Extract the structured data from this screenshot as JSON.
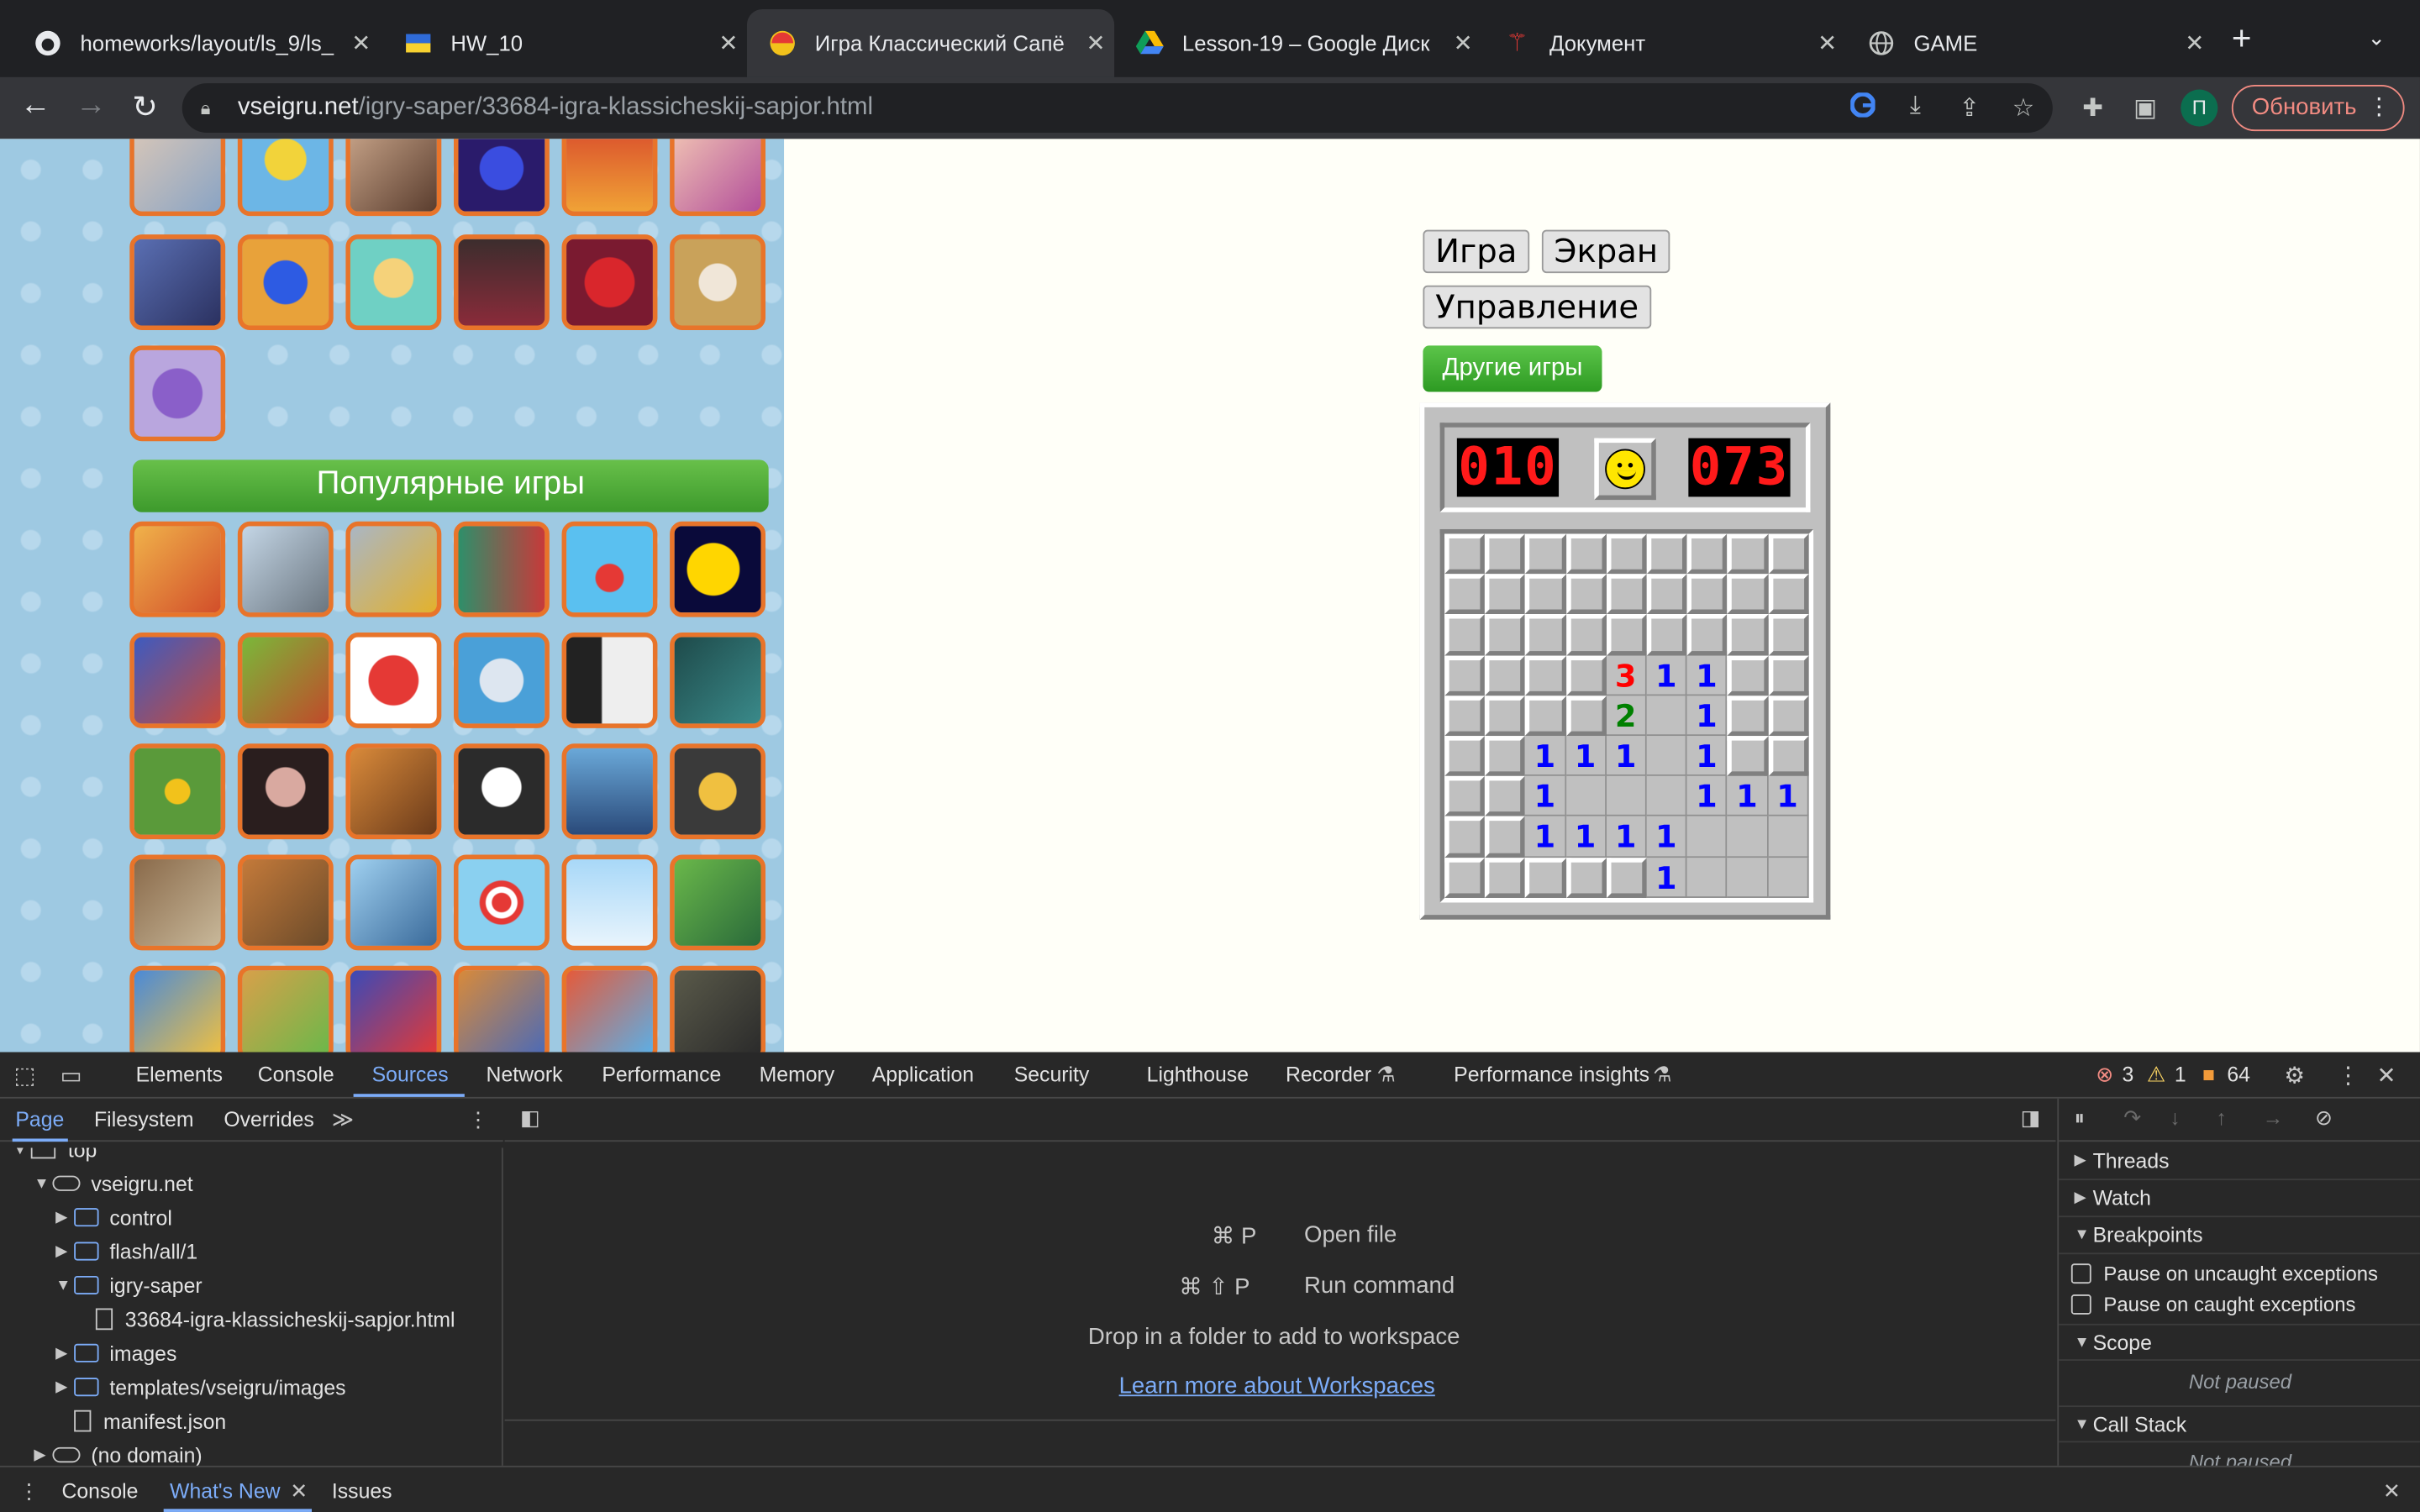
{
  "tabs": [
    {
      "title": "homeworks/layout/ls_9/ls_",
      "icon": "github-icon"
    },
    {
      "title": "HW_10",
      "icon": "ukraine-flag-icon"
    },
    {
      "title": "Игра Классический Сапё",
      "icon": "vseigru-icon",
      "active": true
    },
    {
      "title": "Lesson-19 – Google Диск",
      "icon": "google-drive-icon"
    },
    {
      "title": "Документ",
      "icon": "document-icon"
    },
    {
      "title": "GAME",
      "icon": "globe-icon"
    }
  ],
  "toolbar": {
    "url_domain": "vseigru.net",
    "url_path": "/igry-saper/33684-igra-klassicheskij-sapjor.html",
    "update_label": "Обновить",
    "avatar_letter": "П"
  },
  "sidebar": {
    "popular_title": "Популярные игры"
  },
  "game_menu": {
    "game_button": "Игра",
    "screen_button": "Экран",
    "controls_button": "Управление",
    "other_games_button": "Другие игры"
  },
  "minesweeper": {
    "mines_counter": "010",
    "timer": "073",
    "board": [
      [
        "#",
        "#",
        "#",
        "#",
        "#",
        "#",
        "#",
        "#",
        "#"
      ],
      [
        "#",
        "#",
        "#",
        "#",
        "#",
        "#",
        "#",
        "#",
        "#"
      ],
      [
        "#",
        "#",
        "#",
        "#",
        "#",
        "#",
        "#",
        "#",
        "#"
      ],
      [
        "#",
        "#",
        "#",
        "#",
        "3",
        "1",
        "1",
        "#",
        "#"
      ],
      [
        "#",
        "#",
        "#",
        "#",
        "2",
        "",
        "1",
        "#",
        "#"
      ],
      [
        "#",
        "#",
        "1",
        "1",
        "1",
        "",
        "1",
        "#",
        "#"
      ],
      [
        "#",
        "#",
        "1",
        "",
        "",
        "",
        "1",
        "1",
        "1"
      ],
      [
        "#",
        "#",
        "1",
        "1",
        "1",
        "1",
        "",
        "",
        ""
      ],
      [
        "#",
        "#",
        "#",
        "#",
        "#",
        "1",
        "",
        "",
        ""
      ]
    ],
    "number_colors": {
      "1": "#0000ff",
      "2": "#008000",
      "3": "#ff0000"
    }
  },
  "devtools": {
    "tabs": [
      "Elements",
      "Console",
      "Sources",
      "Network",
      "Performance",
      "Memory",
      "Application",
      "Security",
      "Lighthouse",
      "Recorder",
      "Performance insights"
    ],
    "active_tab": "Sources",
    "errors": "3",
    "warnings": "1",
    "issues": "64",
    "navigator_tabs": [
      "Page",
      "Filesystem",
      "Overrides"
    ],
    "tree": [
      {
        "label": "top",
        "depth": 0,
        "type": "frame",
        "open": true
      },
      {
        "label": "vseigru.net",
        "depth": 1,
        "type": "cloud",
        "open": true
      },
      {
        "label": "control",
        "depth": 2,
        "type": "folder",
        "open": false
      },
      {
        "label": "flash/all/1",
        "depth": 2,
        "type": "folder",
        "open": false
      },
      {
        "label": "igry-saper",
        "depth": 2,
        "type": "folder",
        "open": true
      },
      {
        "label": "33684-igra-klassicheskij-sapjor.html",
        "depth": 3,
        "type": "file"
      },
      {
        "label": "images",
        "depth": 2,
        "type": "folder",
        "open": false
      },
      {
        "label": "templates/vseigru/images",
        "depth": 2,
        "type": "folder",
        "open": false
      },
      {
        "label": "manifest.json",
        "depth": 2,
        "type": "file"
      },
      {
        "label": "(no domain)",
        "depth": 1,
        "type": "cloud",
        "open": false
      }
    ],
    "shortcuts": [
      {
        "keys": "⌘ P",
        "action": "Open file"
      },
      {
        "keys": "⌘ ⇧ P",
        "action": "Run command"
      }
    ],
    "drop_text": "Drop in a folder to add to workspace",
    "learn_link": "Learn more about Workspaces",
    "right_sections": [
      "Threads",
      "Watch",
      "Breakpoints",
      "Scope",
      "Call Stack"
    ],
    "checkboxes": [
      "Pause on uncaught exceptions",
      "Pause on caught exceptions"
    ],
    "not_paused": "Not paused",
    "drawer_tabs": [
      "Console",
      "What's New",
      "Issues"
    ],
    "drawer_active": "What's New"
  }
}
